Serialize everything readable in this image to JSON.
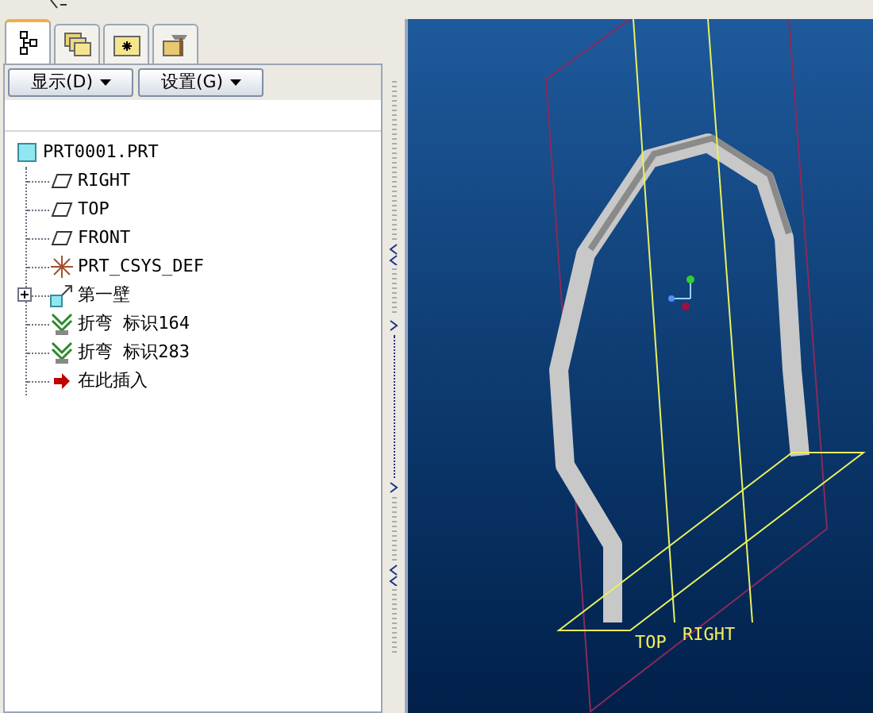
{
  "tabs": [
    {
      "kind": "tree",
      "selected": true
    },
    {
      "kind": "folders",
      "selected": false
    },
    {
      "kind": "favorites",
      "selected": false
    },
    {
      "kind": "tools",
      "selected": false
    }
  ],
  "toolbar": {
    "buttons": [
      "显示(D)",
      "设置(G)"
    ]
  },
  "tree": [
    {
      "label": "PRT0001.PRT",
      "kind": "part",
      "children": [
        {
          "label": "RIGHT",
          "kind": "plane"
        },
        {
          "label": "TOP",
          "kind": "plane"
        },
        {
          "label": "FRONT",
          "kind": "plane"
        },
        {
          "label": "PRT_CSYS_DEF",
          "kind": "csys"
        },
        {
          "label": "第一壁",
          "kind": "wall",
          "expanded": false
        },
        {
          "label": "折弯 标识164",
          "kind": "bend"
        },
        {
          "label": "折弯 标识283",
          "kind": "bend"
        },
        {
          "label": "在此插入",
          "kind": "insert"
        }
      ]
    }
  ],
  "viewport": {
    "datum_labels": [
      "TOP",
      "RIGHT"
    ]
  }
}
